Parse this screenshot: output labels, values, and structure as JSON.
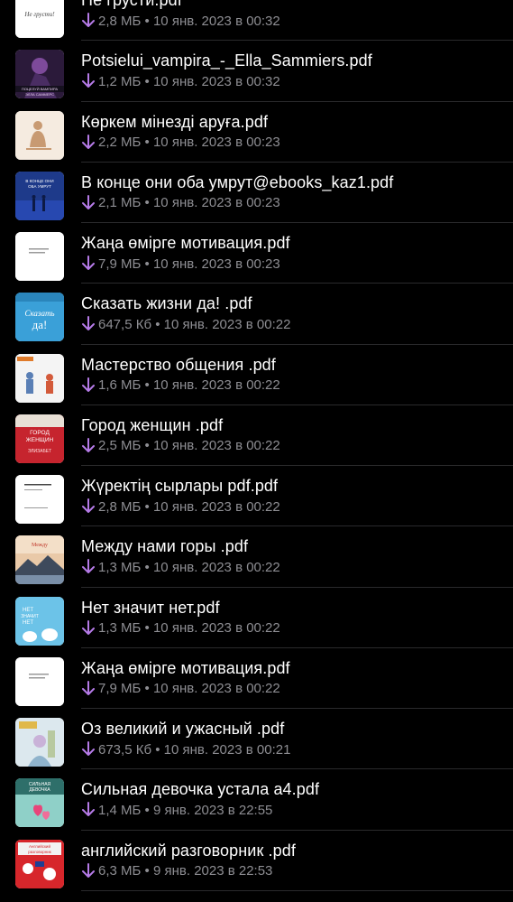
{
  "theme": {
    "background": "#000000",
    "text": "#ffffff",
    "meta_text": "#8e8e93",
    "download_icon_color": "#b67be8"
  },
  "files": [
    {
      "name": "Не грусти.pdf",
      "size": "2,8 МБ",
      "date": "10 янв. 2023 в 00:32",
      "thumb": "white-cover"
    },
    {
      "name": "Potsielui_vampira_-_Ella_Sammiers.pdf",
      "size": "1,2 МБ",
      "date": "10 янв. 2023 в 00:32",
      "thumb": "vampire-cover"
    },
    {
      "name": "Көркем мінезді аруға.pdf",
      "size": "2,2 МБ",
      "date": "10 янв. 2023 в 00:23",
      "thumb": "beige-figure-cover"
    },
    {
      "name": "В конце они оба умрут@ebooks_kaz1.pdf",
      "size": "2,1 МБ",
      "date": "10 янв. 2023 в 00:23",
      "thumb": "blue-night-cover"
    },
    {
      "name": "Жаңа өмірге мотивация.pdf",
      "size": "7,9 МБ",
      "date": "10 янв. 2023 в 00:23",
      "thumb": "white-text-cover"
    },
    {
      "name": "Сказать жизни да! .pdf",
      "size": "647,5 Кб",
      "date": "10 янв. 2023 в 00:22",
      "thumb": "light-blue-cover"
    },
    {
      "name": "Мастерство общения .pdf",
      "size": "1,6 МБ",
      "date": "10 янв. 2023 в 00:22",
      "thumb": "people-talking-cover"
    },
    {
      "name": "Город женщин .pdf",
      "size": "2,5 МБ",
      "date": "10 янв. 2023 в 00:22",
      "thumb": "red-cover"
    },
    {
      "name": "Жүректің сырлары pdf.pdf",
      "size": "2,8 МБ",
      "date": "10 янв. 2023 в 00:22",
      "thumb": "white-doc-cover"
    },
    {
      "name": "Между нами горы .pdf",
      "size": "1,3 МБ",
      "date": "10 янв. 2023 в 00:22",
      "thumb": "mountain-cover"
    },
    {
      "name": "Нет значит нет.pdf",
      "size": "1,3 МБ",
      "date": "10 янв. 2023 в 00:22",
      "thumb": "blue-birds-cover"
    },
    {
      "name": "Жаңа өмірге мотивация.pdf",
      "size": "7,9 МБ",
      "date": "10 янв. 2023 в 00:22",
      "thumb": "white-text-cover"
    },
    {
      "name": "Оз великий и ужасный .pdf",
      "size": "673,5 Кб",
      "date": "10 янв. 2023 в 00:21",
      "thumb": "fairy-tale-cover"
    },
    {
      "name": "Сильная девочка устала а4.pdf",
      "size": "1,4 МБ",
      "date": "9 янв. 2023 в 22:55",
      "thumb": "hearts-cover"
    },
    {
      "name": "английский разговорник .pdf",
      "size": "6,3 МБ",
      "date": "9 янв. 2023 в 22:53",
      "thumb": "red-phrasebook-cover"
    }
  ],
  "meta_separator": "•"
}
